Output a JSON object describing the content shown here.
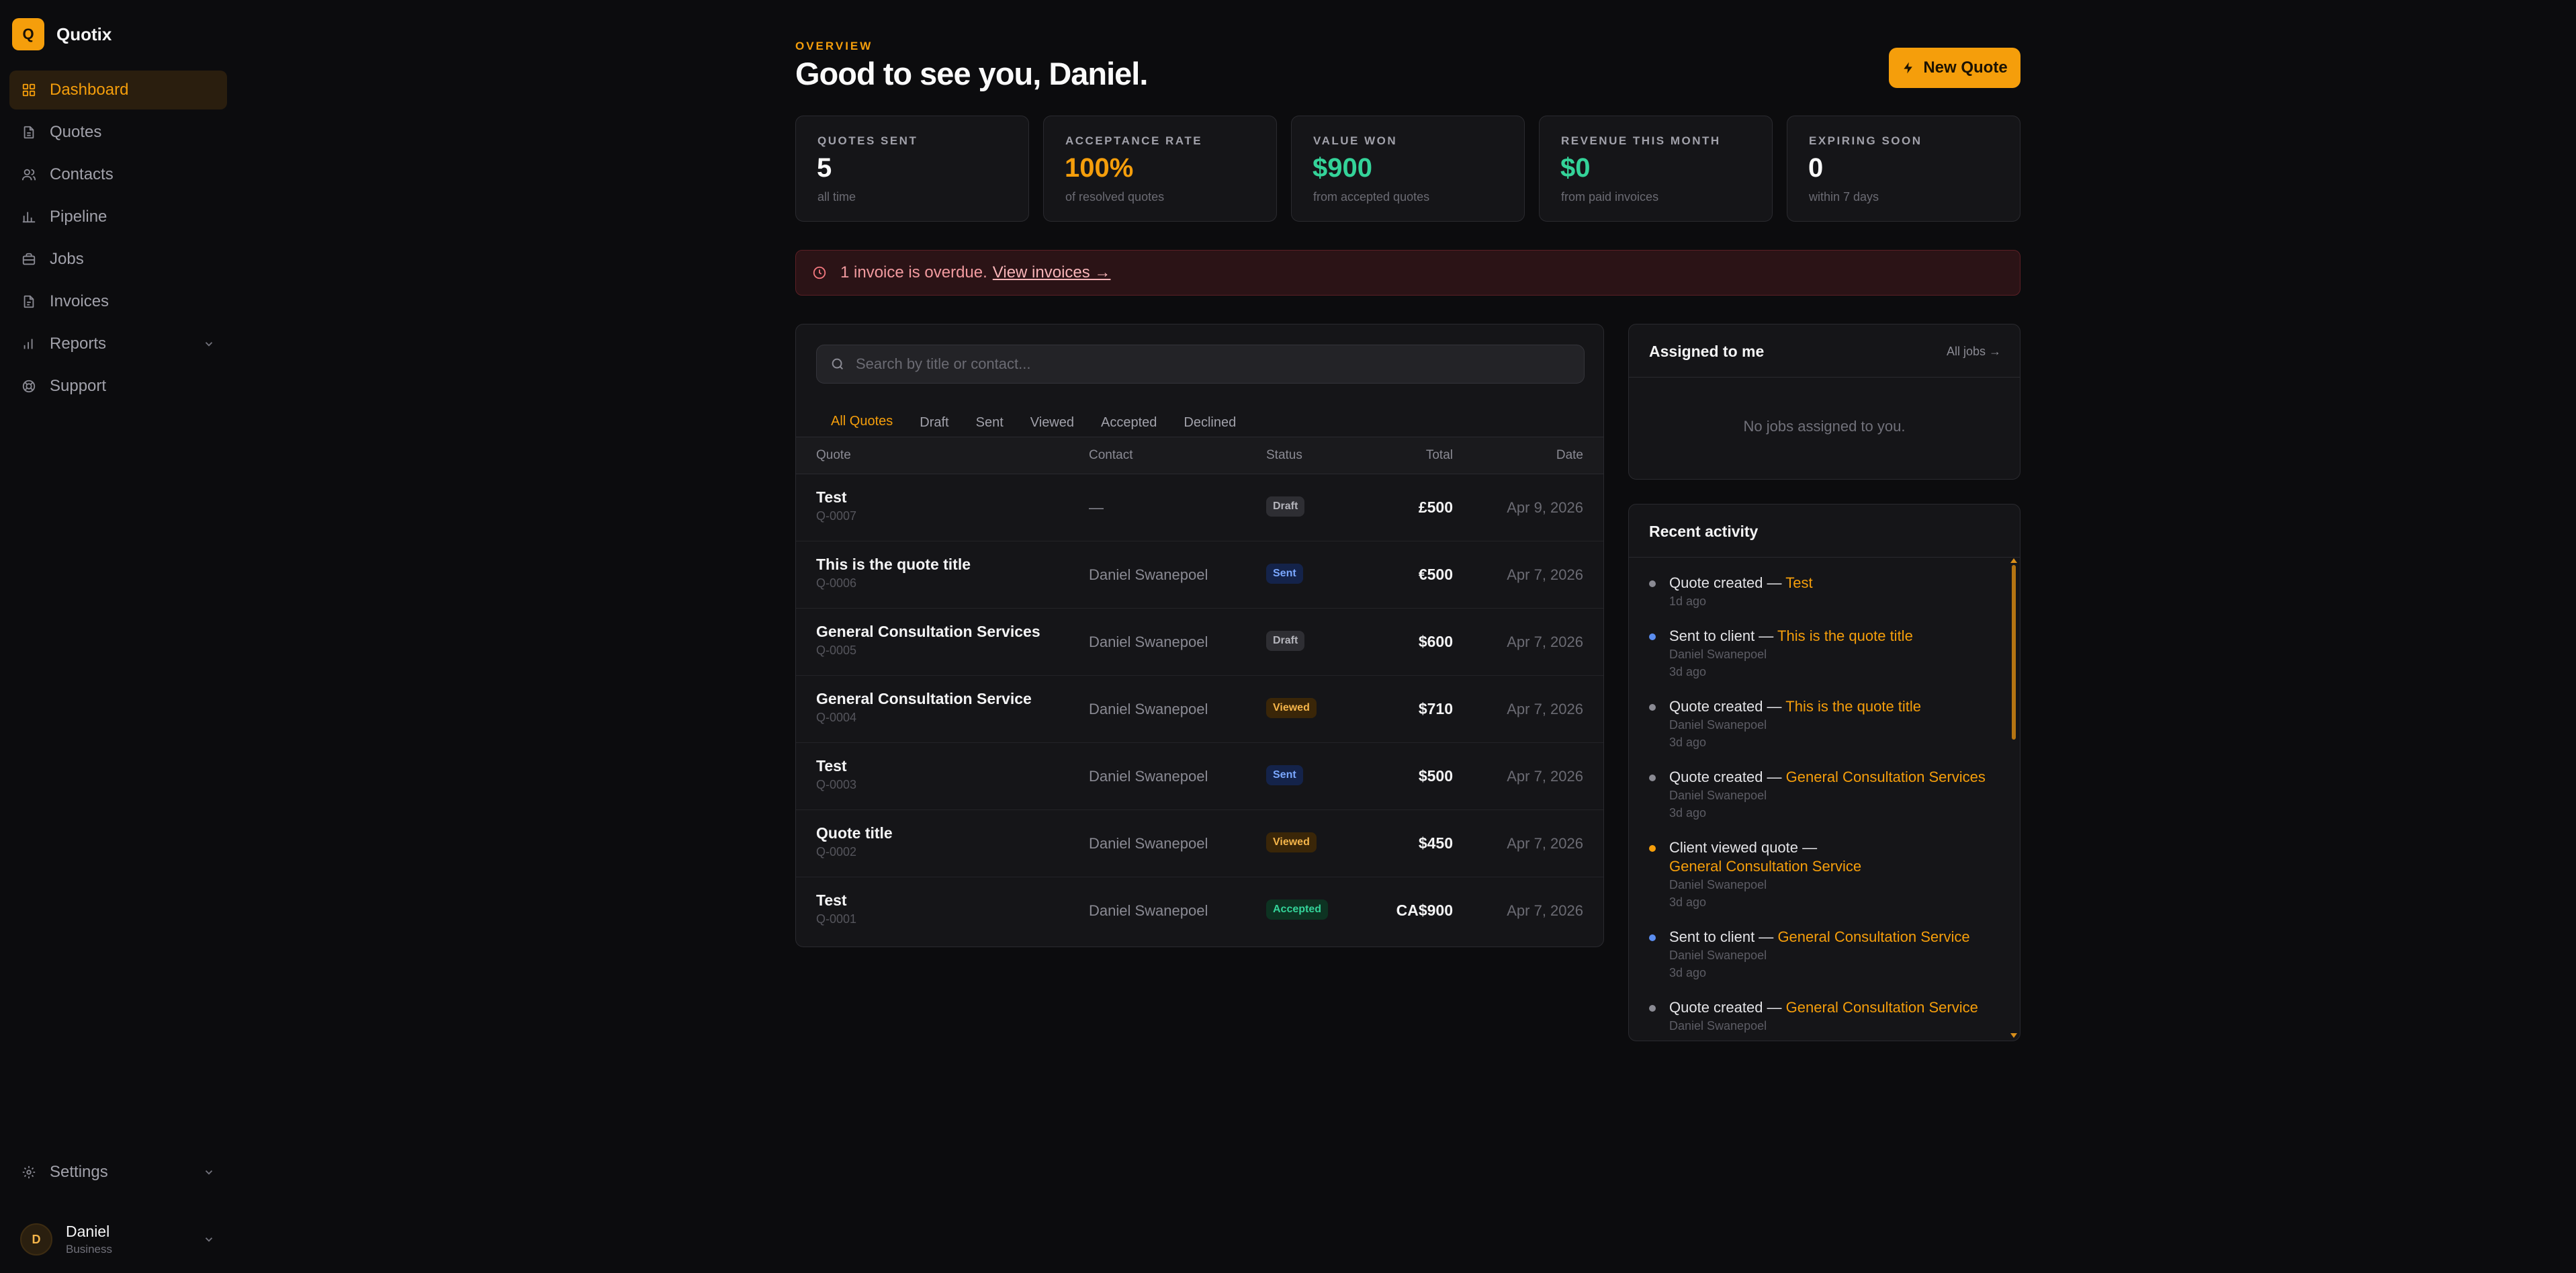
{
  "brand": {
    "logo_letter": "Q",
    "name": "Quotix",
    "accent": "#f59e0b"
  },
  "sidebar": {
    "items": [
      {
        "label": "Dashboard",
        "icon": "grid-icon",
        "active": true
      },
      {
        "label": "Quotes",
        "icon": "document-icon"
      },
      {
        "label": "Contacts",
        "icon": "users-icon"
      },
      {
        "label": "Pipeline",
        "icon": "bar-chart-icon"
      },
      {
        "label": "Jobs",
        "icon": "briefcase-icon"
      },
      {
        "label": "Invoices",
        "icon": "receipt-icon"
      },
      {
        "label": "Reports",
        "icon": "chart-icon",
        "expandable": true
      },
      {
        "label": "Support",
        "icon": "lifebuoy-icon"
      }
    ],
    "settings_label": "Settings",
    "user": {
      "initial": "D",
      "name": "Daniel",
      "plan": "Business"
    }
  },
  "header": {
    "eyebrow": "OVERVIEW",
    "greeting": "Good to see you, Daniel.",
    "new_quote_label": "New Quote"
  },
  "stats": [
    {
      "label": "QUOTES SENT",
      "value": "5",
      "sub": "all time",
      "color": "#fafafa"
    },
    {
      "label": "ACCEPTANCE RATE",
      "value": "100%",
      "sub": "of resolved quotes",
      "color": "#f59e0b"
    },
    {
      "label": "VALUE WON",
      "value": "$900",
      "sub": "from accepted quotes",
      "color": "#34d399"
    },
    {
      "label": "REVENUE THIS MONTH",
      "value": "$0",
      "sub": "from paid invoices",
      "color": "#34d399"
    },
    {
      "label": "EXPIRING SOON",
      "value": "0",
      "sub": "within 7 days",
      "color": "#fafafa"
    }
  ],
  "alert": {
    "text": "1 invoice is overdue.",
    "link": "View invoices →"
  },
  "quotes": {
    "search_placeholder": "Search by title or contact...",
    "tabs": [
      "All Quotes",
      "Draft",
      "Sent",
      "Viewed",
      "Accepted",
      "Declined"
    ],
    "active_tab": "All Quotes",
    "columns": {
      "quote": "Quote",
      "contact": "Contact",
      "status": "Status",
      "total": "Total",
      "date": "Date"
    },
    "rows": [
      {
        "title": "Test",
        "number": "Q-0007",
        "contact": "—",
        "status": "Draft",
        "total": "£500",
        "date": "Apr 9, 2026"
      },
      {
        "title": "This is the quote title",
        "number": "Q-0006",
        "contact": "Daniel Swanepoel",
        "status": "Sent",
        "total": "€500",
        "date": "Apr 7, 2026"
      },
      {
        "title": "General Consultation Services",
        "number": "Q-0005",
        "contact": "Daniel Swanepoel",
        "status": "Draft",
        "total": "$600",
        "date": "Apr 7, 2026"
      },
      {
        "title": "General Consultation Service",
        "number": "Q-0004",
        "contact": "Daniel Swanepoel",
        "status": "Viewed",
        "total": "$710",
        "date": "Apr 7, 2026"
      },
      {
        "title": "Test",
        "number": "Q-0003",
        "contact": "Daniel Swanepoel",
        "status": "Sent",
        "total": "$500",
        "date": "Apr 7, 2026"
      },
      {
        "title": "Quote title",
        "number": "Q-0002",
        "contact": "Daniel Swanepoel",
        "status": "Viewed",
        "total": "$450",
        "date": "Apr 7, 2026"
      },
      {
        "title": "Test",
        "number": "Q-0001",
        "contact": "Daniel Swanepoel",
        "status": "Accepted",
        "total": "CA$900",
        "date": "Apr 7, 2026"
      }
    ]
  },
  "assigned": {
    "title": "Assigned to me",
    "link": "All jobs →",
    "empty": "No jobs assigned to you."
  },
  "activity": {
    "title": "Recent activity",
    "items": [
      {
        "action": "Quote created —",
        "target": "Test",
        "by": "",
        "time": "1d ago",
        "dot": "#8a8a93"
      },
      {
        "action": "Sent to client —",
        "target": "This is the quote title",
        "by": "Daniel Swanepoel",
        "time": "3d ago",
        "dot": "#5b8def"
      },
      {
        "action": "Quote created —",
        "target": "This is the quote title",
        "by": "Daniel Swanepoel",
        "time": "3d ago",
        "dot": "#8a8a93"
      },
      {
        "action": "Quote created —",
        "target": "General Consultation Services",
        "by": "Daniel Swanepoel",
        "time": "3d ago",
        "dot": "#8a8a93"
      },
      {
        "action": "Client viewed quote —",
        "target": "General Consultation Service",
        "by": "Daniel Swanepoel",
        "time": "3d ago",
        "dot": "#f59e0b"
      },
      {
        "action": "Sent to client —",
        "target": "General Consultation Service",
        "by": "Daniel Swanepoel",
        "time": "3d ago",
        "dot": "#5b8def"
      },
      {
        "action": "Quote created —",
        "target": "General Consultation Service",
        "by": "Daniel Swanepoel",
        "time": "",
        "dot": "#8a8a93"
      }
    ]
  }
}
